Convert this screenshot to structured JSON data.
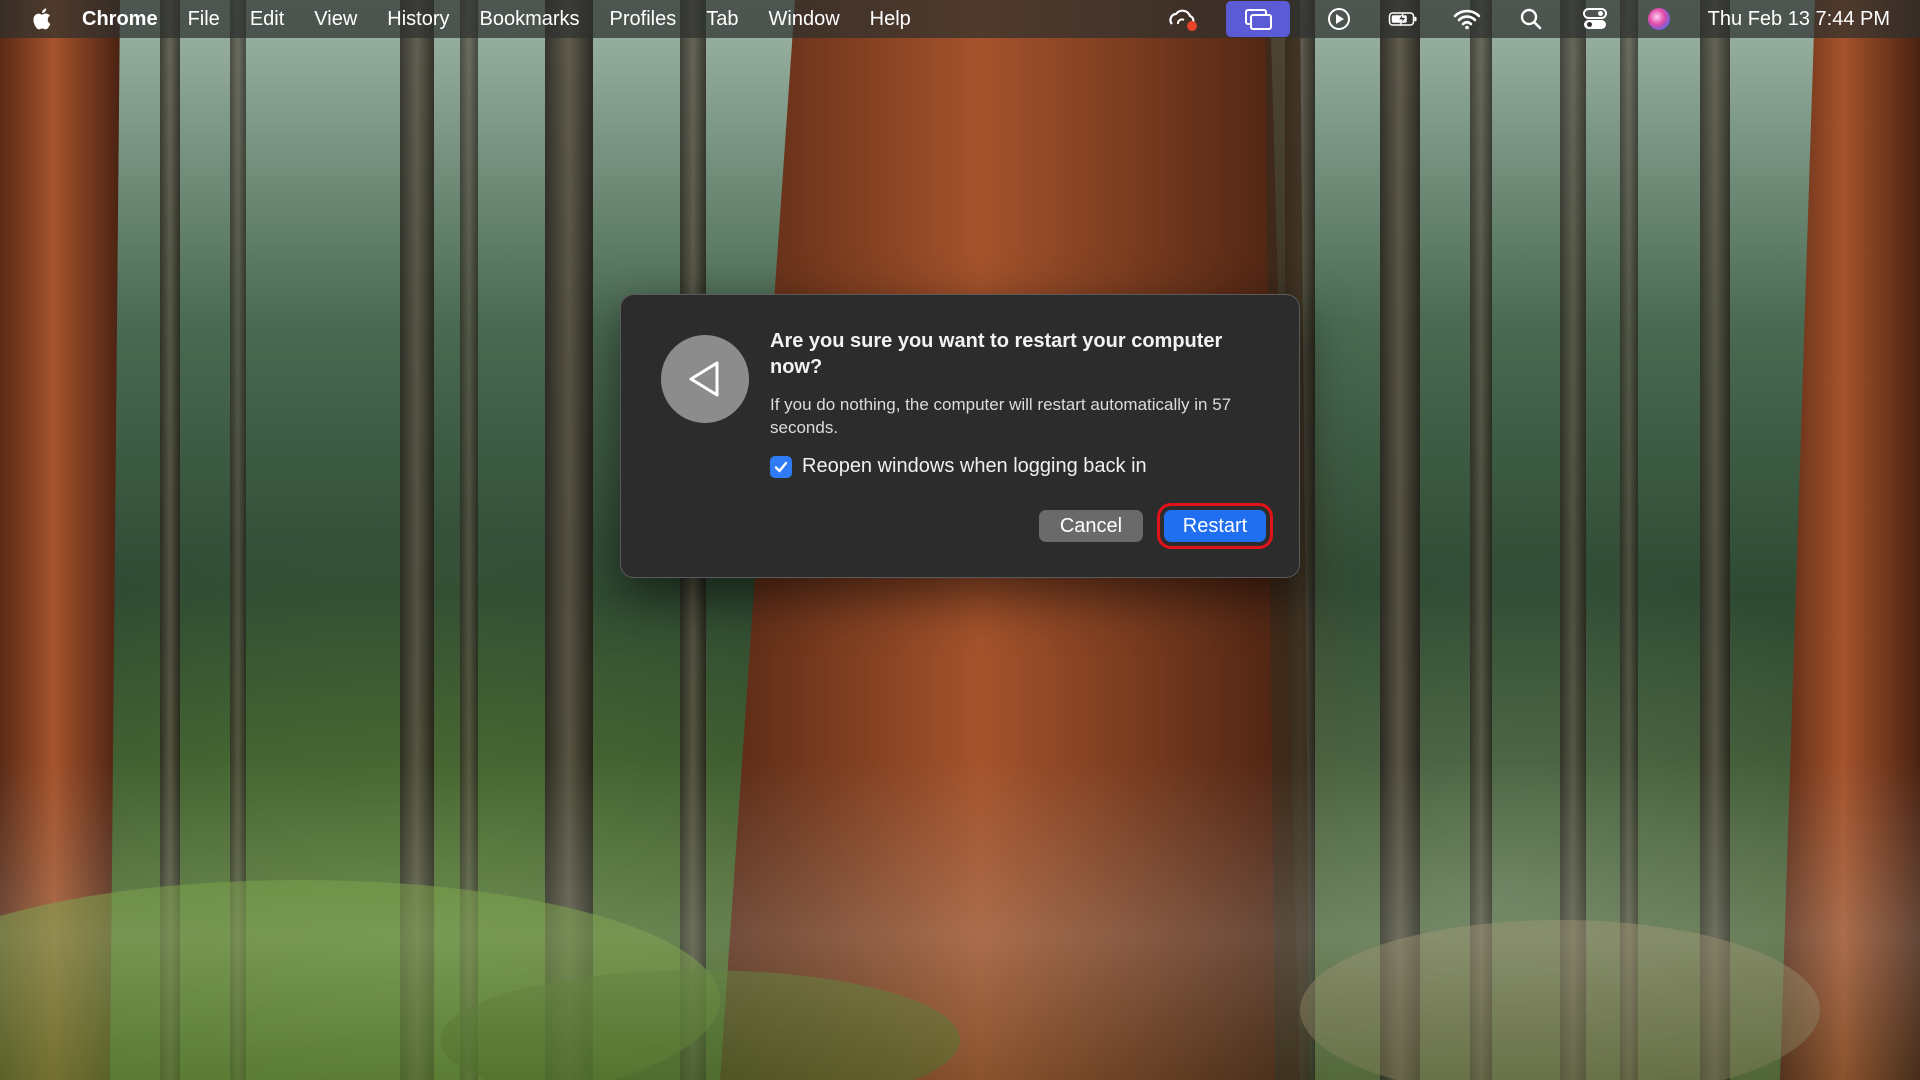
{
  "menubar": {
    "app_name": "Chrome",
    "menus": [
      "File",
      "Edit",
      "View",
      "History",
      "Bookmarks",
      "Profiles",
      "Tab",
      "Window",
      "Help"
    ],
    "clock": "Thu Feb 13  7:44 PM",
    "status_icons": [
      "creative-cloud-icon",
      "screen-mirroring-icon",
      "play-icon",
      "battery-charging-icon",
      "wifi-icon",
      "spotlight-search-icon",
      "control-center-icon",
      "siri-icon"
    ]
  },
  "dialog": {
    "title": "Are you sure you want to restart your computer now?",
    "message": "If you do nothing, the computer will restart automatically in 57 seconds.",
    "checkbox_label": "Reopen windows when logging back in",
    "checkbox_checked": true,
    "cancel_label": "Cancel",
    "restart_label": "Restart",
    "icon": "restart-icon"
  },
  "colors": {
    "accent": "#1f6ff0",
    "highlight_box": "#e0121a",
    "dialog_bg": "#2c2c2c"
  }
}
